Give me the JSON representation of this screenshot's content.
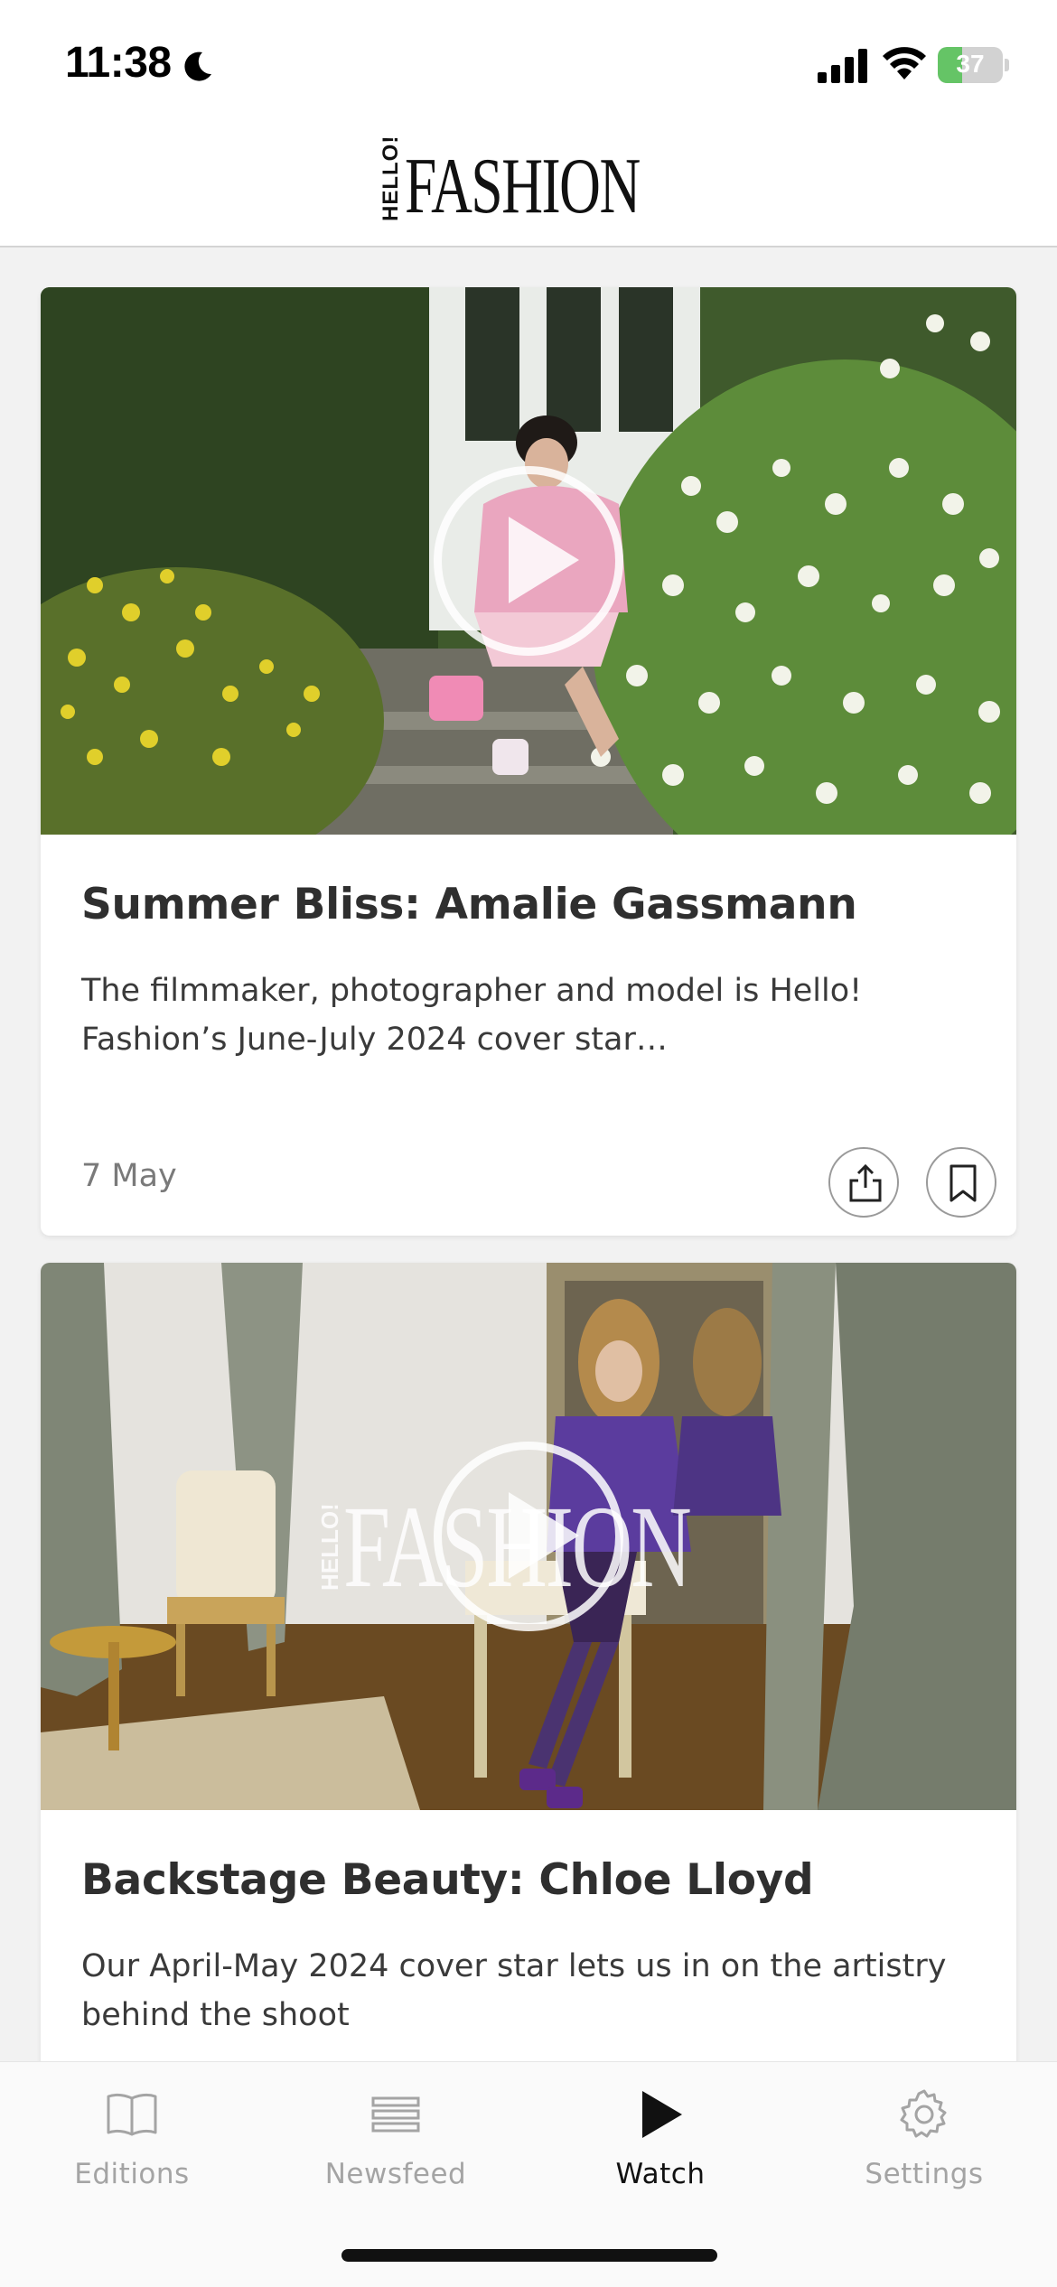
{
  "status_bar": {
    "time": "11:38",
    "battery_percent": 37,
    "battery_label": "37",
    "icons": [
      "moon-icon",
      "signal-icon",
      "wifi-icon",
      "battery-icon"
    ],
    "battery_color": "#65c466"
  },
  "header": {
    "logo_small": "HELLO!",
    "logo_main": "FASHION"
  },
  "cards": [
    {
      "title": "Summer Bliss: Amalie Gassmann",
      "description": "The filmmaker, photographer and model is Hello! Fashion’s June-July 2024 cover star…",
      "date": "7 May",
      "icons": [
        "play-icon",
        "share-icon",
        "bookmark-icon"
      ]
    },
    {
      "title": "Backstage Beauty: Chloe Lloyd",
      "description": "Our April-May 2024 cover star lets us in on the artistry behind the shoot",
      "watermark_small": "HELLO!",
      "watermark_main": "FASHION",
      "icons": [
        "play-icon"
      ]
    }
  ],
  "tab_bar": {
    "tabs": [
      {
        "label": "Editions",
        "icon": "book-icon",
        "active": false
      },
      {
        "label": "Newsfeed",
        "icon": "newsfeed-icon",
        "active": false
      },
      {
        "label": "Watch",
        "icon": "play-icon",
        "active": true
      },
      {
        "label": "Settings",
        "icon": "gear-icon",
        "active": false
      }
    ],
    "active_color": "#111111",
    "inactive_color": "#a4a4a4"
  }
}
